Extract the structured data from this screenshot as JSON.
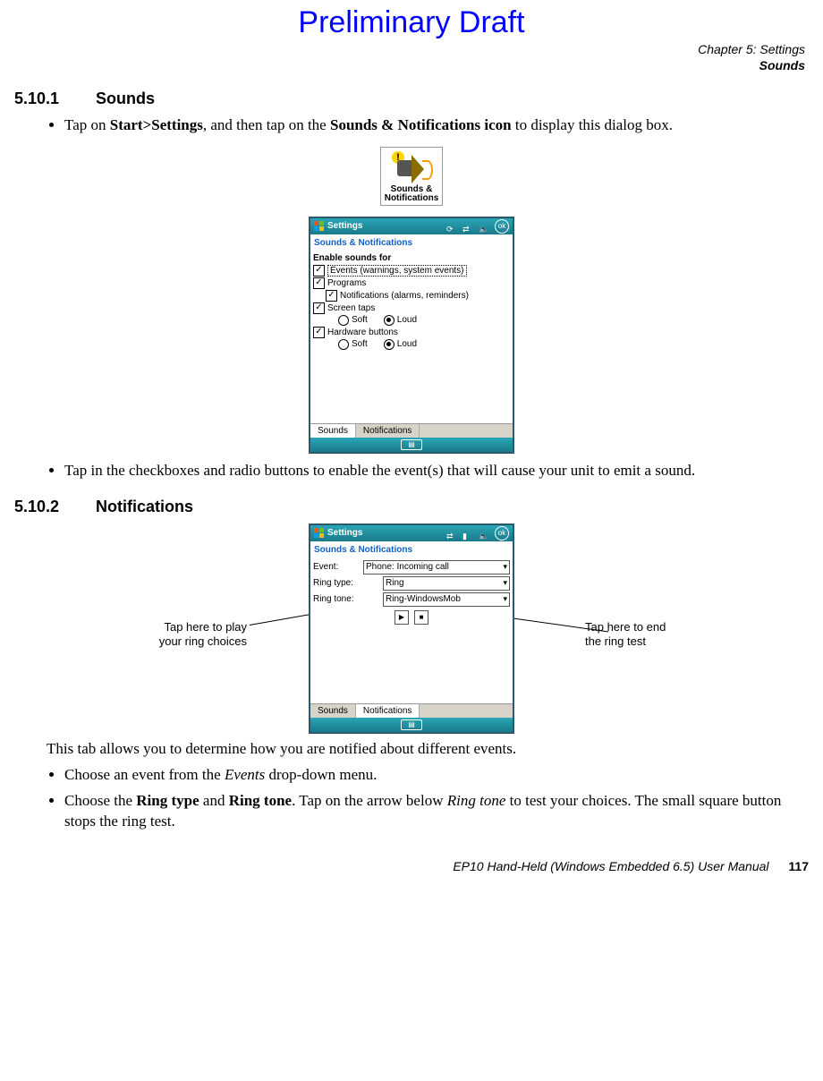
{
  "watermark": "Preliminary Draft",
  "header": {
    "chapter": "Chapter 5:  Settings",
    "topic": "Sounds"
  },
  "sec1": {
    "num": "5.10.1",
    "title": "Sounds",
    "bullet1_pre": "Tap on ",
    "bullet1_b1": "Start>Settings",
    "bullet1_mid": ", and then tap on the ",
    "bullet1_b2": "Sounds & Notifications icon",
    "bullet1_post": " to display this dialog box.",
    "icon_caption_l1": "Sounds &",
    "icon_caption_l2": "Notifications",
    "bullet2": "Tap in the checkboxes and radio buttons to enable the event(s) that will cause your unit to emit a sound."
  },
  "shot1": {
    "title": "Settings",
    "ok": "ok",
    "subtitle": "Sounds & Notifications",
    "enable_label": "Enable sounds for",
    "items": {
      "events": "Events (warnings, system events)",
      "programs": "Programs",
      "notifs": "Notifications (alarms, reminders)",
      "screen": "Screen taps",
      "hw": "Hardware buttons",
      "soft": "Soft",
      "loud": "Loud"
    },
    "tabs": {
      "sounds": "Sounds",
      "notifications": "Notifications"
    }
  },
  "sec2": {
    "num": "5.10.2",
    "title": "Notifications"
  },
  "shot2": {
    "title": "Settings",
    "ok": "ok",
    "subtitle": "Sounds & Notifications",
    "labels": {
      "event": "Event:",
      "ringtype": "Ring type:",
      "ringtone": "Ring tone:"
    },
    "values": {
      "event": "Phone: Incoming call",
      "ringtype": "Ring",
      "ringtone": "Ring-WindowsMob"
    },
    "tabs": {
      "sounds": "Sounds",
      "notifications": "Notifications"
    }
  },
  "callouts": {
    "left_l1": "Tap here to play",
    "left_l2": "your ring choices",
    "right_l1": "Tap here to end",
    "right_l2": "the ring test"
  },
  "after": {
    "p1": "This tab allows you to determine how you are notified about different events.",
    "b1_pre": "Choose an event from the ",
    "b1_i": "Events",
    "b1_post": " drop-down menu.",
    "b2_pre": "Choose the ",
    "b2_b1": "Ring type",
    "b2_mid1": " and ",
    "b2_b2": "Ring tone",
    "b2_mid2": ". Tap on the arrow below ",
    "b2_i": "Ring tone",
    "b2_post": " to test your choices. The small square button stops the ring test."
  },
  "footer": {
    "text": "EP10 Hand-Held (Windows Embedded 6.5) User Manual",
    "page": "117"
  }
}
